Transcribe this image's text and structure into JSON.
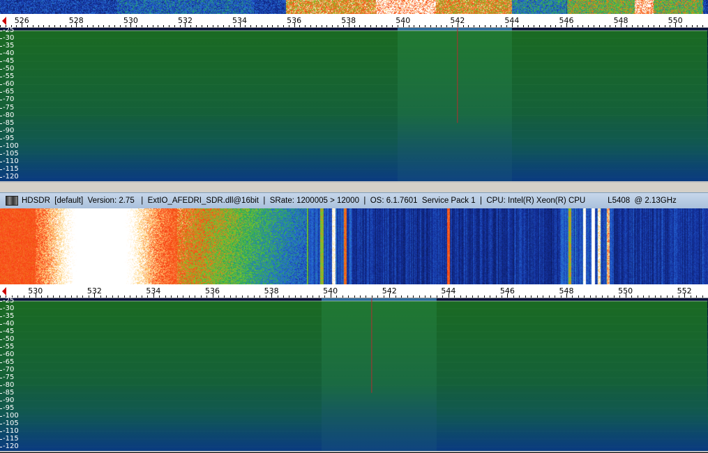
{
  "title_bar": {
    "text": "HDSDR  [default]  Version: 2.75   |  ExtIO_AFEDRI_SDR.dll@16bit  |  SRate: 1200005 > 12000  |  OS: 6.1.7601  Service Pack 1  |  CPU: Intel(R) Xeon(R) CPU          L5408  @ 2.13GHz"
  },
  "top_panel": {
    "freq_labels": [
      "526",
      "528",
      "530",
      "532",
      "534",
      "536",
      "538",
      "540",
      "542",
      "544",
      "546",
      "548",
      "550"
    ],
    "freq_range_khz": [
      525.2,
      551.2
    ],
    "db_labels": [
      "-25",
      "-30",
      "-35",
      "-40",
      "-45",
      "-50",
      "-55",
      "-60",
      "-65",
      "-70",
      "-75",
      "-80",
      "-85",
      "-90",
      "-95",
      "-100",
      "-105",
      "-110",
      "-115",
      "-120"
    ],
    "db_range": [
      -25,
      -120
    ],
    "passband_khz": [
      539.8,
      544.0
    ],
    "tuned_khz": 542.0,
    "colors": {
      "passband": "#2c6b9c",
      "tuned_line": "#b03030",
      "spectrum_fill": "#1e7a1e",
      "spectrum_line": "#a8c8a8"
    }
  },
  "bottom_panel": {
    "freq_labels": [
      "530",
      "532",
      "534",
      "536",
      "538",
      "540",
      "542",
      "544",
      "546",
      "548",
      "550",
      "552"
    ],
    "freq_range_khz": [
      528.8,
      552.8
    ],
    "db_labels": [
      "-25",
      "-30",
      "-35",
      "-40",
      "-45",
      "-50",
      "-55",
      "-60",
      "-65",
      "-70",
      "-75",
      "-80",
      "-85",
      "-90",
      "-95",
      "-100",
      "-105",
      "-110",
      "-115",
      "-120"
    ],
    "db_range": [
      -25,
      -120
    ],
    "passband_khz": [
      539.7,
      543.6
    ],
    "tuned_khz": 541.4,
    "colors": {
      "passband": "#2c6b9c",
      "tuned_line": "#b03030",
      "spectrum_fill": "#1e7a1e",
      "spectrum_line": "#a8c8a8"
    }
  }
}
